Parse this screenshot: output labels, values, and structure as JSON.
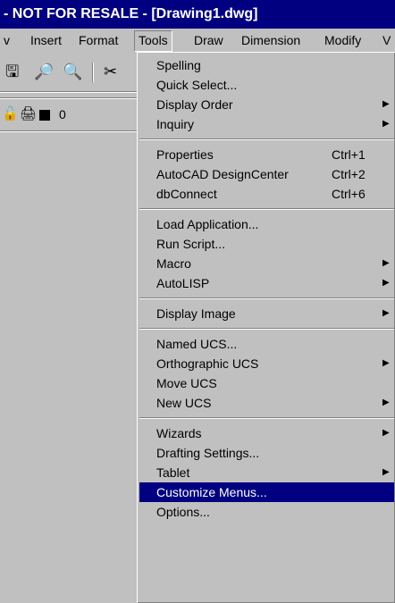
{
  "window": {
    "title": "- NOT FOR RESALE - [Drawing1.dwg]"
  },
  "menubar": {
    "items": [
      {
        "label": "v"
      },
      {
        "label": "Insert"
      },
      {
        "label": "Format"
      },
      {
        "label": "Tools"
      },
      {
        "label": "Draw"
      },
      {
        "label": "Dimension"
      },
      {
        "label": "Modify"
      },
      {
        "label": "V"
      }
    ]
  },
  "toolbar": {
    "icons": [
      "publish-icon",
      "print-preview-icon",
      "spell-check-icon",
      "cut-icon"
    ],
    "layer": {
      "name": "0",
      "icons": [
        "lock-open-icon",
        "printer-icon",
        "color-swatch-icon"
      ]
    }
  },
  "tools_menu": {
    "groups": [
      [
        {
          "label": "Spelling",
          "shortcut": "",
          "submenu": false
        },
        {
          "label": "Quick Select...",
          "shortcut": "",
          "submenu": false
        },
        {
          "label": "Display Order",
          "shortcut": "",
          "submenu": true
        },
        {
          "label": "Inquiry",
          "shortcut": "",
          "submenu": true
        }
      ],
      [
        {
          "label": "Properties",
          "shortcut": "Ctrl+1",
          "submenu": false
        },
        {
          "label": "AutoCAD DesignCenter",
          "shortcut": "Ctrl+2",
          "submenu": false
        },
        {
          "label": "dbConnect",
          "shortcut": "Ctrl+6",
          "submenu": false
        }
      ],
      [
        {
          "label": "Load Application...",
          "shortcut": "",
          "submenu": false
        },
        {
          "label": "Run Script...",
          "shortcut": "",
          "submenu": false
        },
        {
          "label": "Macro",
          "shortcut": "",
          "submenu": true
        },
        {
          "label": "AutoLISP",
          "shortcut": "",
          "submenu": true
        }
      ],
      [
        {
          "label": "Display Image",
          "shortcut": "",
          "submenu": true
        }
      ],
      [
        {
          "label": "Named UCS...",
          "shortcut": "",
          "submenu": false
        },
        {
          "label": "Orthographic UCS",
          "shortcut": "",
          "submenu": true
        },
        {
          "label": "Move UCS",
          "shortcut": "",
          "submenu": false
        },
        {
          "label": "New UCS",
          "shortcut": "",
          "submenu": true
        }
      ],
      [
        {
          "label": "Wizards",
          "shortcut": "",
          "submenu": true
        },
        {
          "label": "Drafting Settings...",
          "shortcut": "",
          "submenu": false
        },
        {
          "label": "Tablet",
          "shortcut": "",
          "submenu": true
        },
        {
          "label": "Customize Menus...",
          "shortcut": "",
          "submenu": false,
          "highlighted": true
        },
        {
          "label": "Options...",
          "shortcut": "",
          "submenu": false
        }
      ]
    ]
  },
  "colors": {
    "title_bg": "#000080",
    "menu_bg": "#c0c0c0",
    "highlight": "#000080"
  }
}
